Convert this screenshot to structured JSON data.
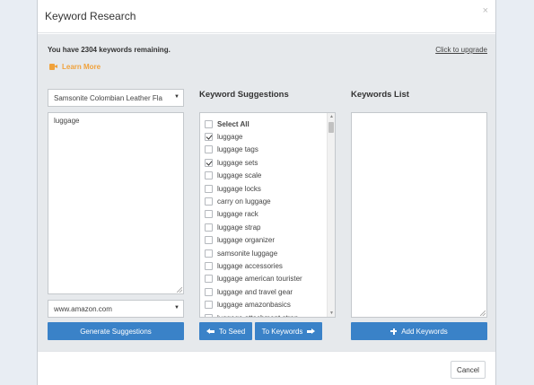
{
  "modal": {
    "title": "Keyword Research",
    "close_glyph": "×"
  },
  "header_info": {
    "remaining_text": "You have 2304 keywords remaining.",
    "upgrade_link": "Click to upgrade",
    "learn_more": "Learn More",
    "learn_more_icon": "video-camera-icon"
  },
  "seed": {
    "product_select": "Samsonite Colombian Leather Fla",
    "seed_text": "luggage",
    "marketplace_select": "www.amazon.com",
    "generate_button": "Generate Suggestions"
  },
  "suggestions": {
    "title": "Keyword Suggestions",
    "items": [
      {
        "label": "Select All",
        "checked": false,
        "bold": true
      },
      {
        "label": "luggage",
        "checked": true
      },
      {
        "label": "luggage tags",
        "checked": false
      },
      {
        "label": "luggage sets",
        "checked": true
      },
      {
        "label": "luggage scale",
        "checked": false
      },
      {
        "label": "luggage locks",
        "checked": false
      },
      {
        "label": "carry on luggage",
        "checked": false
      },
      {
        "label": "luggage rack",
        "checked": false
      },
      {
        "label": "luggage strap",
        "checked": false
      },
      {
        "label": "luggage organizer",
        "checked": false
      },
      {
        "label": "samsonite luggage",
        "checked": false
      },
      {
        "label": "luggage accessories",
        "checked": false
      },
      {
        "label": "luggage american tourister",
        "checked": false
      },
      {
        "label": "luggage and travel gear",
        "checked": false
      },
      {
        "label": "luggage amazonbasics",
        "checked": false
      },
      {
        "label": "luggage attachment strap",
        "checked": false
      }
    ],
    "to_seed_button": "To Seed",
    "to_keywords_button": "To Keywords"
  },
  "keywords_list": {
    "title": "Keywords List",
    "add_button": "Add Keywords"
  },
  "footer": {
    "cancel_button": "Cancel"
  },
  "colors": {
    "primary_button": "#3a82c8",
    "learn_more": "#f0a23c",
    "body_bg": "#e6e9ec"
  }
}
